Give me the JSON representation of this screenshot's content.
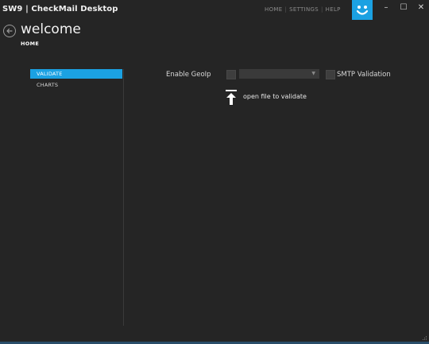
{
  "window": {
    "title": "SW9 | CheckMail Desktop",
    "accent_color": "#1ba1e2",
    "background_color": "#252525",
    "controls": {
      "minimize": "–",
      "maximize": "☐",
      "close": "✕"
    }
  },
  "top_nav": {
    "items": [
      "HOME",
      "SETTINGS",
      "HELP"
    ],
    "separator": "|"
  },
  "header": {
    "title": "welcome",
    "breadcrumb": "HOME",
    "back_icon": "arrow-left-circle-icon",
    "logo_icon": "smiley-face-icon"
  },
  "sidebar": {
    "items": [
      {
        "label": "VALIDATE",
        "active": true
      },
      {
        "label": "CHARTS",
        "active": false
      }
    ]
  },
  "validate_panel": {
    "enable_geoip_label": "Enable GeoIp",
    "enable_geoip_checked": false,
    "geoip_dropdown_value": "",
    "smtp_validation_label": "SMTP Validation",
    "smtp_validation_checked": false,
    "open_file_label": "open file to validate",
    "open_file_icon": "upload-arrow-icon"
  }
}
